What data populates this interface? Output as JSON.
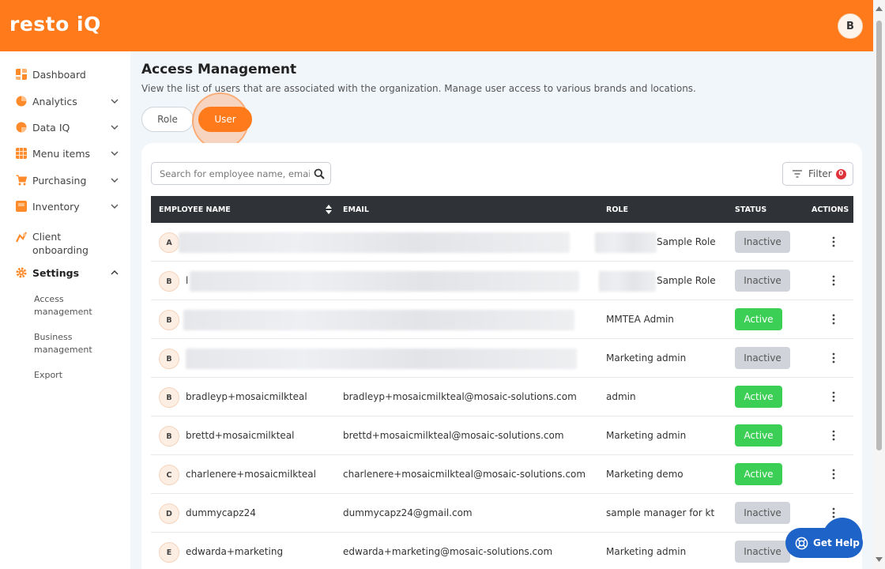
{
  "header": {
    "logo": "resto iQ",
    "user_initial": "B"
  },
  "sidebar": {
    "items": [
      {
        "label": "Dashboard",
        "icon": "dashboard-icon",
        "color": "#ff8a2a",
        "expandable": false
      },
      {
        "label": "Analytics",
        "icon": "analytics-icon",
        "color": "#ff8a2a",
        "expandable": true
      },
      {
        "label": "Data IQ",
        "icon": "data-iq-icon",
        "color": "#ff8a2a",
        "expandable": true
      },
      {
        "label": "Menu items",
        "icon": "menu-items-icon",
        "color": "#ff8a2a",
        "expandable": true
      },
      {
        "label": "Purchasing",
        "icon": "cart-icon",
        "color": "#ff8a2a",
        "expandable": true
      },
      {
        "label": "Inventory",
        "icon": "inventory-icon",
        "color": "#ff8a2a",
        "expandable": true
      },
      {
        "label": "Client onboarding",
        "icon": "onboarding-icon",
        "color": "#ff8a2a",
        "expandable": false
      },
      {
        "label": "Settings",
        "icon": "gear-icon",
        "color": "#ff8a2a",
        "expandable": true,
        "expanded": true
      }
    ],
    "settings_sub": [
      "Access management",
      "Business management",
      "Export"
    ]
  },
  "page": {
    "title": "Access Management",
    "description": "View the list of users that are associated with the organization. Manage user access to various brands and locations.",
    "tabs": [
      {
        "label": "Role"
      },
      {
        "label": "User",
        "active": true
      }
    ]
  },
  "toolbar": {
    "search_placeholder": "Search for employee name, email",
    "filter_label": "Filter",
    "filter_count": "0"
  },
  "table": {
    "columns": [
      "EMPLOYEE NAME",
      "EMAIL",
      "ROLE",
      "STATUS",
      "ACTIONS"
    ],
    "rows": [
      {
        "initial": "A",
        "name": "",
        "email": "",
        "role": "Sample Role",
        "status": "Inactive",
        "redacted": true
      },
      {
        "initial": "B",
        "name": "l",
        "email": "",
        "role": "Sample Role",
        "status": "Inactive",
        "redacted": true
      },
      {
        "initial": "B",
        "name": "",
        "email": "",
        "role": "MMTEA Admin",
        "status": "Active",
        "redacted": true
      },
      {
        "initial": "B",
        "name": "",
        "email": "",
        "role": "Marketing admin",
        "status": "Inactive",
        "redacted": true
      },
      {
        "initial": "B",
        "name": "bradleyp+mosaicmilkteal",
        "email": "bradleyp+mosaicmilkteal@mosaic-solutions.com",
        "role": "admin",
        "status": "Active"
      },
      {
        "initial": "B",
        "name": "brettd+mosaicmilkteal",
        "email": "brettd+mosaicmilkteal@mosaic-solutions.com",
        "role": "Marketing admin",
        "status": "Active"
      },
      {
        "initial": "C",
        "name": "charlenere+mosaicmilkteal",
        "email": "charlenere+mosaicmilkteal@mosaic-solutions.com",
        "role": "Marketing demo",
        "status": "Active"
      },
      {
        "initial": "D",
        "name": "dummycapz24",
        "email": "dummycapz24@gmail.com",
        "role": "sample manager for kt",
        "status": "Inactive"
      },
      {
        "initial": "E",
        "name": "edwarda+marketing",
        "email": "edwarda+marketing@mosaic-solutions.com",
        "role": "Marketing admin",
        "status": "Inactive"
      }
    ]
  },
  "help": {
    "label": "Get Help"
  },
  "colors": {
    "brand": "#ff7a1a",
    "active": "#3ccf55",
    "inactive": "#d0d3d9",
    "table_header": "#2f3237",
    "help": "#1d63c8"
  }
}
